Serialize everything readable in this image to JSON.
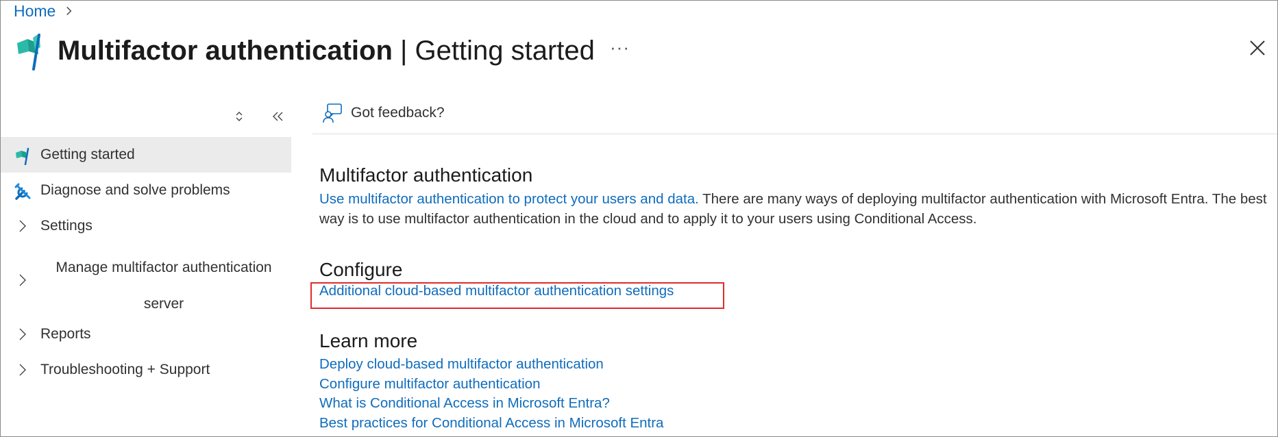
{
  "breadcrumb": {
    "home": "Home"
  },
  "header": {
    "title_bold": "Multifactor authentication",
    "title_sep": " | ",
    "title_sub": "Getting started",
    "more": "···"
  },
  "sidebar": {
    "items": [
      {
        "label": "Getting started",
        "icon": "getting-started-icon",
        "active": true
      },
      {
        "label": "Diagnose and solve problems",
        "icon": "wrench-icon"
      },
      {
        "label": "Settings",
        "expandable": true
      },
      {
        "label": "Manage multifactor authentication server",
        "expandable": true
      },
      {
        "label": "Reports",
        "expandable": true
      },
      {
        "label": "Troubleshooting + Support",
        "expandable": true
      }
    ]
  },
  "toolbar": {
    "feedback": "Got feedback?"
  },
  "main": {
    "intro": {
      "heading": "Multifactor authentication",
      "link": "Use multifactor authentication to protect your users and data.",
      "text": " There are many ways of deploying multifactor authentication with Microsoft Entra. The best way is to use multifactor authentication in the cloud and to apply it to your users using Conditional Access."
    },
    "configure": {
      "heading": "Configure",
      "link": "Additional cloud-based multifactor authentication settings"
    },
    "learn": {
      "heading": "Learn more",
      "links": [
        "Deploy cloud-based multifactor authentication",
        "Configure multifactor authentication",
        "What is Conditional Access in Microsoft Entra?",
        "Best practices for Conditional Access in Microsoft Entra"
      ]
    }
  },
  "colors": {
    "link": "#0f6cbd",
    "highlight": "#e02b2b",
    "active_bg": "#ebebeb"
  }
}
